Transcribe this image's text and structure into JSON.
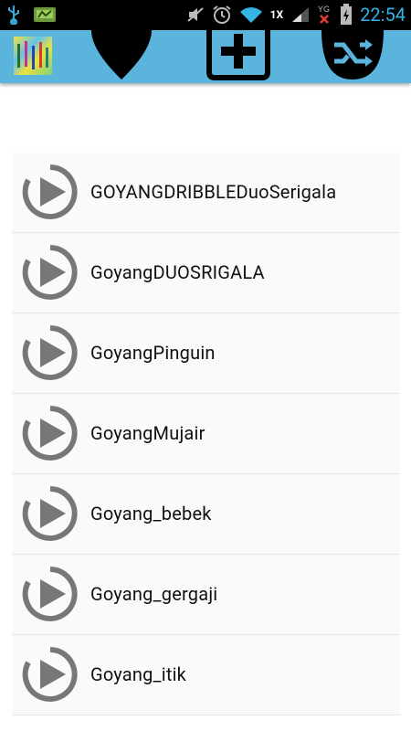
{
  "status_bar": {
    "left_icons": [
      "usb-icon",
      "sd-card-icon"
    ],
    "right_icons": [
      "mute-icon",
      "alarm-icon",
      "wifi-icon",
      "signal-icon",
      "data-off-icon",
      "battery-icon"
    ],
    "speed_label": "1X",
    "time": "22:54"
  },
  "action_bar": {
    "icons": [
      "app-logo",
      "favorite-heart-icon",
      "add-icon",
      "shuffle-icon"
    ],
    "colors": {
      "background": "#5ab4dc"
    }
  },
  "playlist": {
    "items": [
      {
        "title": "GOYANGDRIBBLEDuoSerigala"
      },
      {
        "title": "GoyangDUOSRIGALA"
      },
      {
        "title": "GoyangPinguin"
      },
      {
        "title": "GoyangMujair"
      },
      {
        "title": "Goyang_bebek"
      },
      {
        "title": "Goyang_gergaji"
      },
      {
        "title": "Goyang_itik"
      }
    ]
  }
}
